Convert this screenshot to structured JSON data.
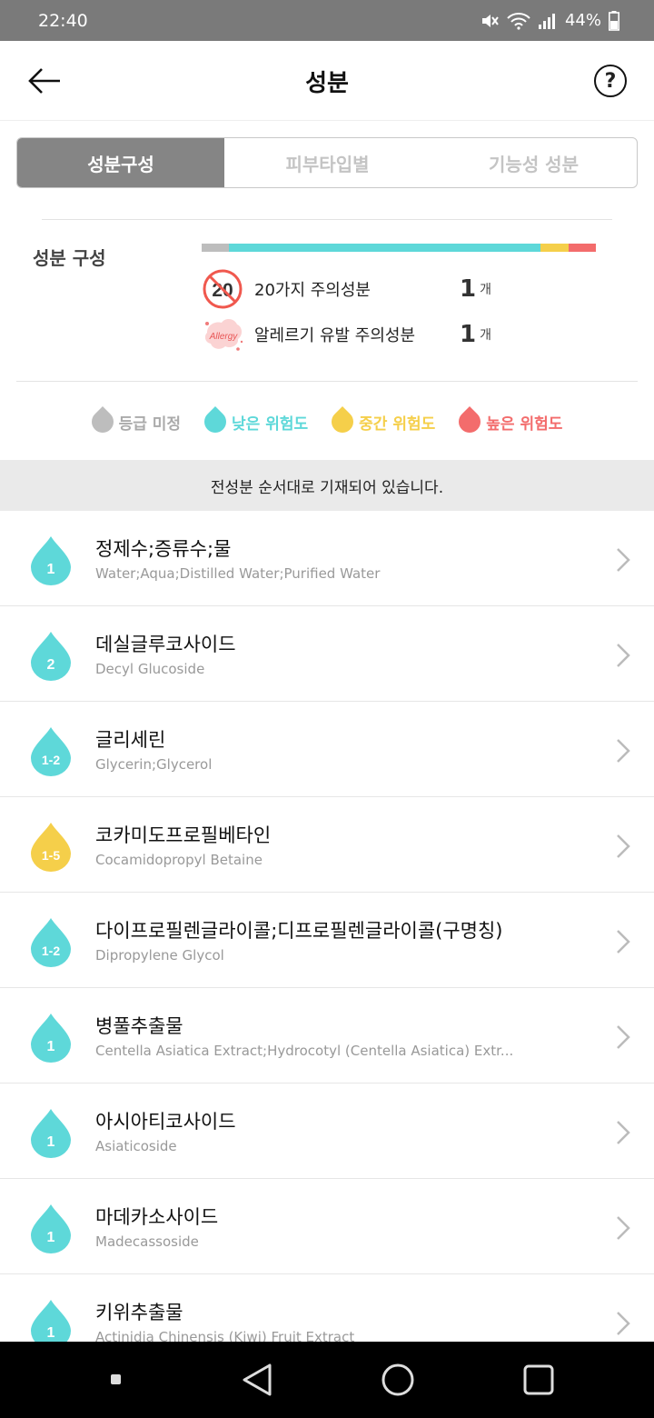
{
  "status_bar": {
    "time": "22:40",
    "battery": "44%"
  },
  "header": {
    "title": "성분"
  },
  "tabs": [
    {
      "label": "성분구성",
      "active": true
    },
    {
      "label": "피부타입별",
      "active": false
    },
    {
      "label": "기능성 성분",
      "active": false
    }
  ],
  "composition": {
    "label": "성분 구성",
    "bar": [
      {
        "grade": "미정",
        "fraction": 0.07,
        "color": "#bdbdbd"
      },
      {
        "grade": "낮은",
        "fraction": 0.79,
        "color": "#5ed8d9"
      },
      {
        "grade": "중간",
        "fraction": 0.07,
        "color": "#f5cf4a"
      },
      {
        "grade": "높은",
        "fraction": 0.07,
        "color": "#f36c6c"
      }
    ],
    "caution20": {
      "icon_text": "20",
      "label": "20가지 주의성분",
      "count": "1",
      "unit": "개"
    },
    "allergy": {
      "icon_text": "Allergy",
      "label": "알레르기 유발 주의성분",
      "count": "1",
      "unit": "개"
    }
  },
  "legend": [
    {
      "label": "등급 미정",
      "color": "#bdbdbd"
    },
    {
      "label": "낮은 위험도",
      "color": "#5ed8d9"
    },
    {
      "label": "중간 위험도",
      "color": "#f5cf4a"
    },
    {
      "label": "높은 위험도",
      "color": "#f36c6c"
    }
  ],
  "notice": "전성분 순서대로 기재되어 있습니다.",
  "ingredients": [
    {
      "grade": "1",
      "color": "#5ed8d9",
      "name_ko": "정제수;증류수;물",
      "name_en": "Water;Aqua;Distilled Water;Purified Water"
    },
    {
      "grade": "2",
      "color": "#5ed8d9",
      "name_ko": "데실글루코사이드",
      "name_en": "Decyl Glucoside"
    },
    {
      "grade": "1-2",
      "color": "#5ed8d9",
      "name_ko": "글리세린",
      "name_en": "Glycerin;Glycerol"
    },
    {
      "grade": "1-5",
      "color": "#f5cf4a",
      "name_ko": "코카미도프로필베타인",
      "name_en": "Cocamidopropyl Betaine"
    },
    {
      "grade": "1-2",
      "color": "#5ed8d9",
      "name_ko": "다이프로필렌글라이콜;디프로필렌글라이콜(구명칭)",
      "name_en": "Dipropylene Glycol"
    },
    {
      "grade": "1",
      "color": "#5ed8d9",
      "name_ko": "병풀추출물",
      "name_en": "Centella Asiatica Extract;Hydrocotyl (Centella Asiatica) Extr..."
    },
    {
      "grade": "1",
      "color": "#5ed8d9",
      "name_ko": "아시아티코사이드",
      "name_en": "Asiaticoside"
    },
    {
      "grade": "1",
      "color": "#5ed8d9",
      "name_ko": "마데카소사이드",
      "name_en": "Madecassoside"
    },
    {
      "grade": "1",
      "color": "#5ed8d9",
      "name_ko": "키위추출물",
      "name_en": "Actinidia Chinensis (Kiwi) Fruit Extract"
    }
  ]
}
